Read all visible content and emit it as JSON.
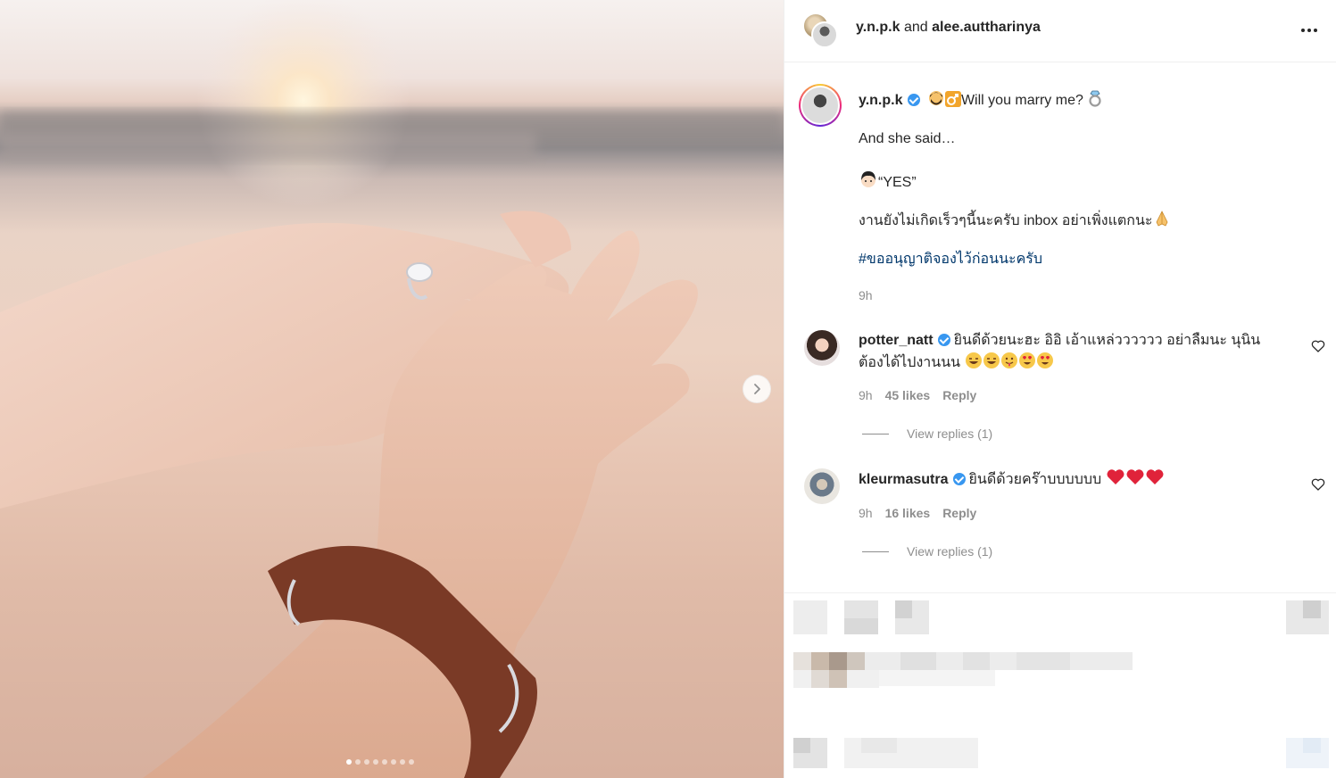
{
  "header": {
    "user1": "y.n.p.k",
    "connector": "and",
    "user2": "alee.auttharinya"
  },
  "caption": {
    "username": "y.n.p.k",
    "line1": "Will you marry me?",
    "line2": "And she said…",
    "line3": "“YES”",
    "line4_a": "งานยังไม่เกิดเร็วๆนี้นะครับ",
    "line4_b": "inbox",
    "line4_c": "อย่าเพิ่งแตกนะ",
    "hashtag": "#ขออนุญาติจองไว้ก่อนนะครับ",
    "time": "9h"
  },
  "comments": [
    {
      "username": "potter_natt",
      "text_line1": "ยินดีด้วยนะฮะ อิอิ เอ้าแหล่วววววว อย่าลืมนะ นุนิน",
      "text_line2": "ต้องได้ไปงานนน",
      "time": "9h",
      "likes": "45 likes",
      "reply": "Reply",
      "view_replies": "View replies (1)"
    },
    {
      "username": "kleurmasutra",
      "text_line1": "ยินดีด้วยคร๊าบบบบบบ",
      "time": "9h",
      "likes": "16 likes",
      "reply": "Reply",
      "view_replies": "View replies (1)"
    }
  ],
  "carousel": {
    "slide_count": 8,
    "active_index": 0
  },
  "colors": {
    "link": "#00376b",
    "verified": "#3897f0",
    "muted": "#8e8e8e",
    "text": "#262626"
  }
}
